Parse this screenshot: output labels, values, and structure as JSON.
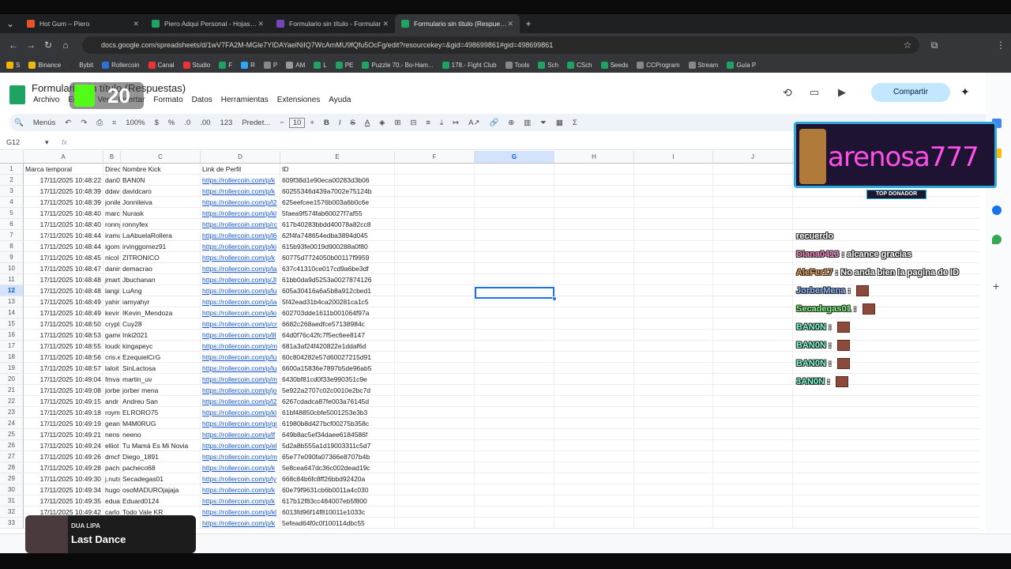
{
  "browser": {
    "tabs": [
      {
        "label": "Hot Gum – Piero",
        "color": "#e8542a"
      },
      {
        "label": "Piero Adqui Personal - Hojas de",
        "color": "#1ea362"
      },
      {
        "label": "Formulario sin título - Formular",
        "color": "#7248b9"
      },
      {
        "label": "Formulario sin título (Respuesta",
        "color": "#1ea362"
      }
    ],
    "url": "docs.google.com/spreadsheets/d/1wV7FA2M-MGle7YIDAYaelNiIQ7WcAmMU9fQfu5OcFg/edit?resourcekey=&gid=498699861#gid=498699861",
    "bookmarks": [
      "S",
      "Binance",
      "Bybit",
      "Rollercoin",
      "Canal",
      "Studio",
      "F",
      "R",
      "P",
      "AM",
      "L",
      "PE",
      "Puzzle 70.- Bo-Ham...",
      "178.- Fight Club",
      "Tools",
      "Sch",
      "CSch",
      "Seeds",
      "CCProgram",
      "Stream",
      "Guía P"
    ]
  },
  "sheets": {
    "title": "Formulario sin título (Respuestas)",
    "menu": [
      "Archivo",
      "Editar",
      "Ver",
      "Insertar",
      "Formato",
      "Datos",
      "Herramientas",
      "Extensiones",
      "Ayuda"
    ],
    "share_label": "Compartir",
    "toolbar": {
      "menus_label": "Menús",
      "zoom": "100%",
      "currency": "$",
      "percent": "%",
      "dec_less": ".0",
      "dec_more": ".00",
      "number_format": "123",
      "font": "Predet...",
      "font_size": "10"
    },
    "cell_ref": "G12",
    "fx": "fx",
    "columns": [
      "A",
      "B",
      "C",
      "D",
      "E",
      "F",
      "G",
      "H",
      "I",
      "J"
    ],
    "header_row": [
      "Marca temporal",
      "Direc",
      "Nombre Kick",
      "Link de Perfil",
      "ID"
    ],
    "rows": [
      [
        "17/11/2025 10:48:22",
        "dan0",
        "BAN0N",
        "https://rollercoin.com/p/k",
        "609f38d1e90eca00283d3b06"
      ],
      [
        "17/11/2025 10:48:39",
        "ddav",
        "davidcaro",
        "https://rollercoin.com/p/k",
        "60255346d439a7002e75124b"
      ],
      [
        "17/11/2025 10:48:39",
        "jonile",
        "Jonnileiva",
        "https://rollercoin.com/p/l2",
        "625eefcee1576b003a6b0c6e"
      ],
      [
        "17/11/2025 10:48:40",
        "marc",
        "Nurask",
        "https://rollercoin.com/p/kl",
        "5faea9f574fab60027f7af55"
      ],
      [
        "17/11/2025 10:48:40",
        "ronny",
        "ronnyfex",
        "https://rollercoin.com/p/rc",
        "617b40283bbdd40078a82cc8"
      ],
      [
        "17/11/2025 10:48:44",
        "irama",
        "LaAbuelaRollera",
        "https://rollercoin.com/p/l6",
        "62f4fa748654edba3894d045"
      ],
      [
        "17/11/2025 10:48:44",
        "igom",
        "irvinggomez91",
        "https://rollercoin.com/p/ki",
        "615b93fe0019d900288a0f80"
      ],
      [
        "17/11/2025 10:48:45",
        "nicol",
        "ZITRONICO",
        "https://rollercoin.com/p/k",
        "60775d7724050b00117f9959"
      ],
      [
        "17/11/2025 10:48:47",
        "danir",
        "demacrao",
        "https://rollercoin.com/p/la",
        "637c41310ce017cd9a6be3df"
      ],
      [
        "17/11/2025 10:48:48",
        "jmart",
        "Jbuchanan",
        "https://rollercoin.com/p/Jl",
        "61bb0da9d5253a0027874126"
      ],
      [
        "17/11/2025 10:48:48",
        "langi",
        "LuAng",
        "https://rollercoin.com/p/lu",
        "605a30416a6a5b8a912cbed1"
      ],
      [
        "17/11/2025 10:48:49",
        "yahir",
        "iamyahyr",
        "https://rollercoin.com/p/ia",
        "5f42ead31b4ca200281ca1c5"
      ],
      [
        "17/11/2025 10:48:49",
        "kevir",
        "IKevin_Mendoza",
        "https://rollercoin.com/p/ki",
        "602703dde1611b001064f97a"
      ],
      [
        "17/11/2025 10:48:50",
        "crypt",
        "Cuy28",
        "https://rollercoin.com/p/cr",
        "6682c268aedfce57138984c"
      ],
      [
        "17/11/2025 10:48:53",
        "game",
        "Inki2021",
        "https://rollercoin.com/p/lll",
        "64d0f76c42fc7f5ec6ee8147"
      ],
      [
        "17/11/2025 10:48:55",
        "loudc",
        "kingapeyc",
        "https://rollercoin.com/p/m",
        "681a3af24f420822e1ddaf6d"
      ],
      [
        "17/11/2025 10:48:56",
        "cris.e",
        "EzequielCrG",
        "https://rollercoin.com/p/lu",
        "60c804282e57d60027215d91"
      ],
      [
        "17/11/2025 10:48:57",
        "laloit",
        "SinLactosa",
        "https://rollercoin.com/p/lu",
        "6600a15836e7897b5de96ab5"
      ],
      [
        "17/11/2025 10:49:04",
        "fmva",
        "martin_uv",
        "https://rollercoin.com/p/m",
        "6430bf81cd0f33e990351c9e"
      ],
      [
        "17/11/2025 10:49:08",
        "jorbe",
        "jorber mena",
        "https://rollercoin.com/p/jo",
        "5e922a2707c02c0010e2bc7d"
      ],
      [
        "17/11/2025 10:49:15",
        "andr",
        "Andreu San",
        "https://rollercoin.com/p/l2",
        "6267cdadca87fe003a76145d"
      ],
      [
        "17/11/2025 10:49:18",
        "roym",
        "ELRORO75",
        "https://rollercoin.com/p/kl",
        "61bf48850cbfe5001253e3b3"
      ],
      [
        "17/11/2025 10:49:19",
        "gean",
        "M4M0RUG",
        "https://rollercoin.com/p/gi",
        "61980b8d427bcf00275b358c"
      ],
      [
        "17/11/2025 10:49:21",
        "nens",
        "neeno",
        "https://rollercoin.com/p/lf",
        "649b8ac5ef34daee6184586f"
      ],
      [
        "17/11/2025 10:49:24",
        "elliot",
        "Tu Mamá Es Mi Novia",
        "https://rollercoin.com/p/el",
        "5d2a8b555a1d19003311c5d7"
      ],
      [
        "17/11/2025 10:49:26",
        "dmcf",
        "Diego_1891",
        "https://rollercoin.com/p/m",
        "65e77e090fa07366e8707b4b"
      ],
      [
        "17/11/2025 10:49:28",
        "pach",
        "pacheco68",
        "https://rollercoin.com/p/k",
        "5e8cea647dc36c002dead19c"
      ],
      [
        "17/11/2025 10:49:30",
        "j.nuts",
        "Secadegas01",
        "https://rollercoin.com/p/ly",
        "668c84b6fc8ff26bbd92420a"
      ],
      [
        "17/11/2025 10:49:34",
        "hugo",
        "osoMADUROjajaja",
        "https://rollercoin.com/p/k",
        "60e79f9631cb6b0011a4c030"
      ],
      [
        "17/11/2025 10:49:35",
        "edua",
        "Eduard0124",
        "https://rollercoin.com/p/k",
        "617b12f83cc484007eb5f800"
      ],
      [
        "17/11/2025 10:49:42",
        "carlo",
        "Todo Vale KR",
        "https://rollercoin.com/p/kl",
        "6013fd96f14f810011e1033c"
      ],
      [
        "17/11/2025 10:49:43",
        "",
        "",
        "https://rollercoin.com/p/k",
        "5efead64f0c0f100114dbc55"
      ]
    ]
  },
  "overlay": {
    "name": "arenosa777",
    "badge": "TOP DONADOR"
  },
  "chat": [
    {
      "user": "",
      "msg": "recuerdo",
      "color": "#ffffff"
    },
    {
      "user": "Diana0413",
      "msg": "alcance gracias",
      "color": "#ff8ac4"
    },
    {
      "user": "AleFer17",
      "msg": "No anda bien la pagina de ID",
      "color": "#f0a050"
    },
    {
      "user": "JorberMena",
      "msg": "",
      "color": "#8cb4ff"
    },
    {
      "user": "Secadegas01",
      "msg": "",
      "color": "#7cff7c"
    },
    {
      "user": "BAN0N",
      "msg": "",
      "color": "#7cffd0"
    },
    {
      "user": "BAN0N",
      "msg": "",
      "color": "#7cffd0"
    },
    {
      "user": "BAN0N",
      "msg": "",
      "color": "#7cffd0"
    },
    {
      "user": "3AN0N",
      "msg": "",
      "color": "#7cffd0"
    }
  ],
  "nowplaying": {
    "artist": "DUA LIPA",
    "title": "Last Dance"
  },
  "kick_badge": "20"
}
